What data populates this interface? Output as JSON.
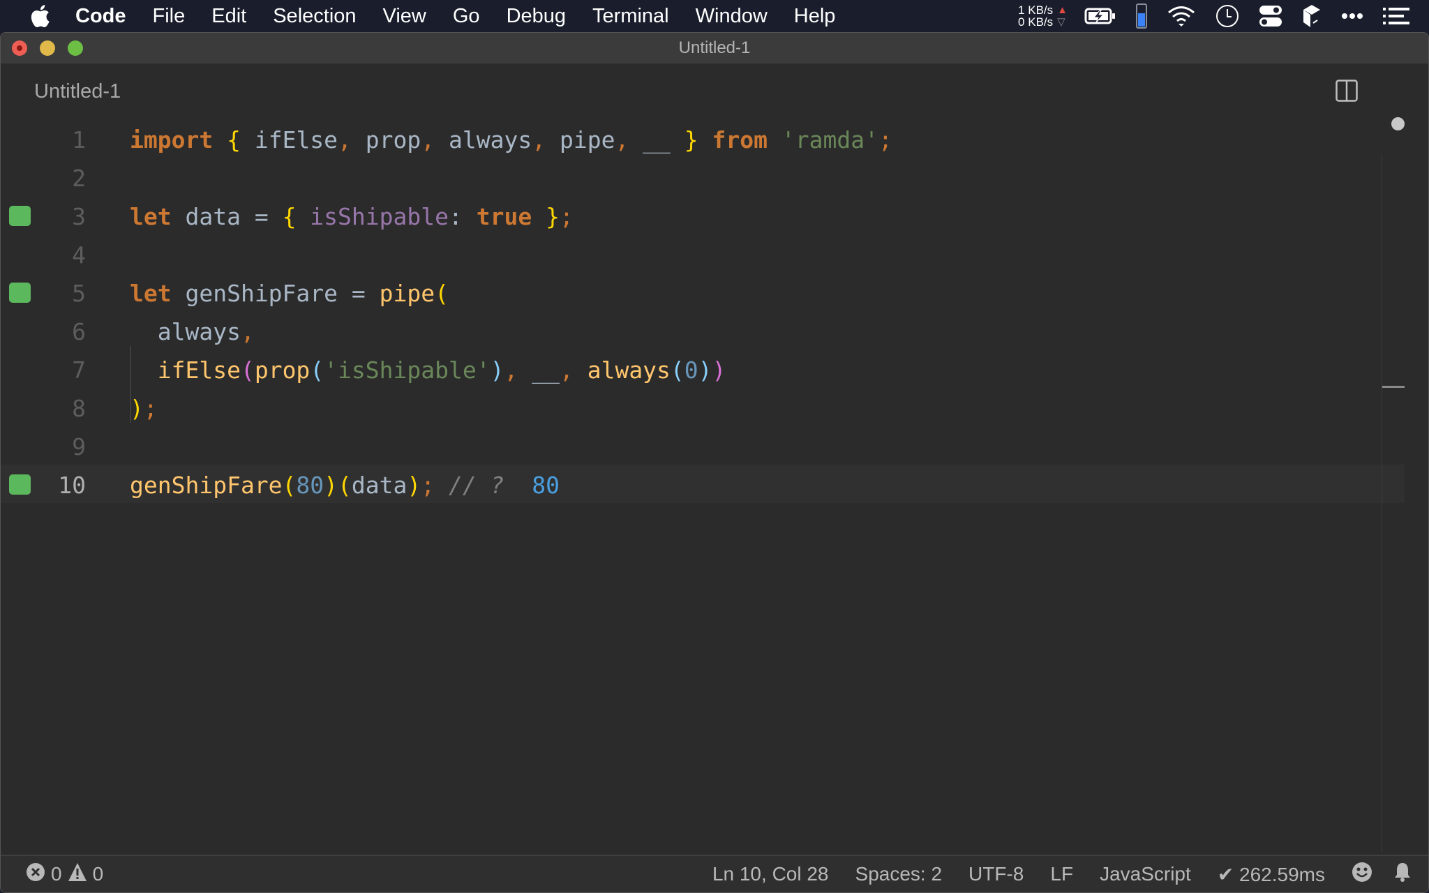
{
  "menubar": {
    "app_name": "Code",
    "items": [
      "File",
      "Edit",
      "Selection",
      "View",
      "Go",
      "Debug",
      "Terminal",
      "Window",
      "Help"
    ],
    "net_up": "1 KB/s",
    "net_down": "0 KB/s",
    "tray_icons": [
      "battery-charging-icon",
      "memory-gauge-icon",
      "wifi-icon",
      "clock-icon",
      "control-center-icon",
      "cube-app-icon",
      "more-icon",
      "list-icon"
    ],
    "memory_fill": 0.6
  },
  "window": {
    "title": "Untitled-1",
    "tab_title": "Untitled-1"
  },
  "editor": {
    "language": "JavaScript",
    "lines": [
      {
        "n": "1",
        "marker": false,
        "current": false
      },
      {
        "n": "2",
        "marker": false,
        "current": false
      },
      {
        "n": "3",
        "marker": true,
        "current": false
      },
      {
        "n": "4",
        "marker": false,
        "current": false
      },
      {
        "n": "5",
        "marker": true,
        "current": false
      },
      {
        "n": "6",
        "marker": false,
        "current": false
      },
      {
        "n": "7",
        "marker": false,
        "current": false
      },
      {
        "n": "8",
        "marker": false,
        "current": false
      },
      {
        "n": "9",
        "marker": false,
        "current": false
      },
      {
        "n": "10",
        "marker": true,
        "current": true
      }
    ],
    "tokens": {
      "l1": [
        "import",
        "{",
        " ifElse",
        ",",
        " prop",
        ",",
        " always",
        ",",
        " pipe",
        ",",
        " __ ",
        "}",
        " from ",
        "'ramda'",
        ";"
      ],
      "l3": [
        "let",
        " data = ",
        "{",
        " isShipable",
        ": ",
        "true",
        " ",
        "}",
        ";"
      ],
      "l5": [
        "let",
        " genShipFare = ",
        "pipe",
        "("
      ],
      "l6": [
        "  always",
        ","
      ],
      "l7": [
        "  ifElse",
        "(",
        "prop",
        "(",
        "'isShipable'",
        ")",
        ",",
        " __",
        ",",
        " always",
        "(",
        "0",
        ")",
        ")"
      ],
      "l8": [
        ")",
        ";"
      ],
      "l10": [
        "genShipFare",
        "(",
        "80",
        ")",
        "(",
        "data",
        ")",
        ";",
        " // ? ",
        " 80"
      ]
    },
    "quokka_result": "80"
  },
  "statusbar": {
    "errors": "0",
    "warnings": "0",
    "cursor": "Ln 10, Col 28",
    "indent": "Spaces: 2",
    "encoding": "UTF-8",
    "eol": "LF",
    "language": "JavaScript",
    "timing": "✔ 262.59ms"
  }
}
